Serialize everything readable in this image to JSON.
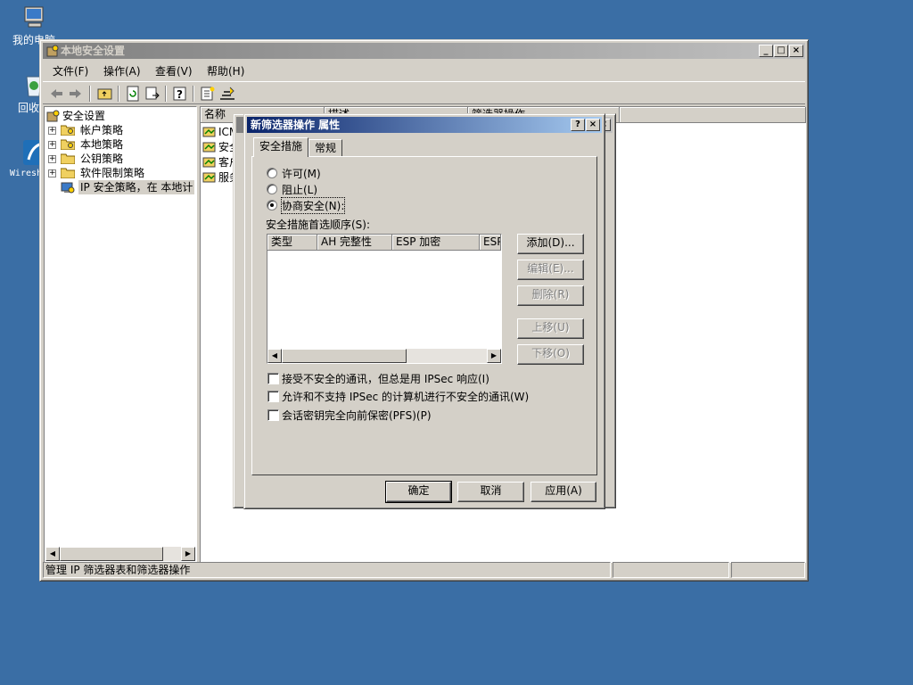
{
  "desktop": {
    "icons": [
      {
        "label": "我的电脑"
      },
      {
        "label": "回收站"
      },
      {
        "label": "Wireshark"
      }
    ]
  },
  "main_window": {
    "title": "本地安全设置",
    "menu": [
      "文件(F)",
      "操作(A)",
      "查看(V)",
      "帮助(H)"
    ],
    "tree": [
      {
        "label": "安全设置"
      },
      {
        "label": "帐户策略"
      },
      {
        "label": "本地策略"
      },
      {
        "label": "公钥策略"
      },
      {
        "label": "软件限制策略"
      },
      {
        "label": "IP 安全策略，在 本地计"
      }
    ],
    "list": {
      "columns": [
        "名称",
        "描述",
        "筛选器操作"
      ],
      "rows": [
        "ICM",
        "安全",
        "客户",
        "服务"
      ]
    },
    "status_text": "管理 IP 筛选器表和筛选器操作"
  },
  "dialog": {
    "title": "新筛选器操作 属性",
    "help_btn": "?",
    "close_btn": "×",
    "tabs": [
      "安全措施",
      "常规"
    ],
    "radios": [
      {
        "label": "许可(M)",
        "checked": false
      },
      {
        "label": "阻止(L)",
        "checked": false
      },
      {
        "label": "协商安全(N):",
        "checked": true
      }
    ],
    "order_label": "安全措施首选顺序(S):",
    "table_columns": [
      "类型",
      "AH 完整性",
      "ESP 加密",
      "ESP"
    ],
    "side_buttons": {
      "add": "添加(D)...",
      "edit": "编辑(E)...",
      "remove": "删除(R)",
      "move_up": "上移(U)",
      "move_down": "下移(O)"
    },
    "checkboxes": [
      {
        "label": "接受不安全的通讯，但总是用 IPSec 响应(I)",
        "checked": false
      },
      {
        "label": "允许和不支持 IPSec 的计算机进行不安全的通讯(W)",
        "checked": false
      },
      {
        "label": "会话密钥完全向前保密(PFS)(P)",
        "checked": false
      }
    ],
    "buttons": {
      "ok": "确定",
      "cancel": "取消",
      "apply": "应用(A)"
    }
  }
}
